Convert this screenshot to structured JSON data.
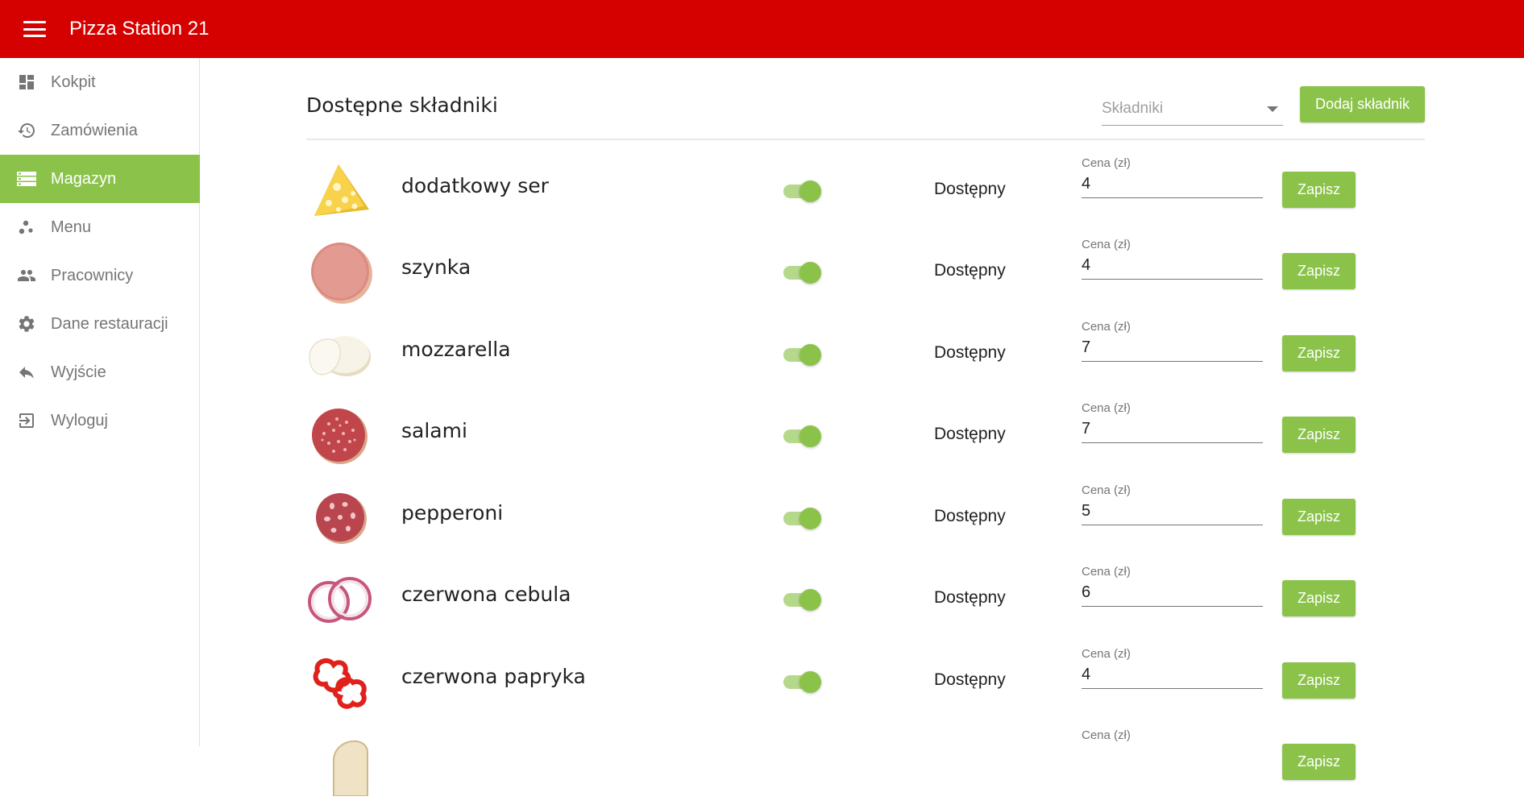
{
  "app": {
    "title": "Pizza Station 21"
  },
  "sidebar": {
    "items": [
      {
        "label": "Kokpit",
        "icon": "dashboard-icon",
        "active": false
      },
      {
        "label": "Zamówienia",
        "icon": "history-icon",
        "active": false
      },
      {
        "label": "Magazyn",
        "icon": "storage-icon",
        "active": true
      },
      {
        "label": "Menu",
        "icon": "bubbles-icon",
        "active": false
      },
      {
        "label": "Pracownicy",
        "icon": "people-icon",
        "active": false
      },
      {
        "label": "Dane restauracji",
        "icon": "gear-icon",
        "active": false
      },
      {
        "label": "Wyjście",
        "icon": "reply-icon",
        "active": false
      },
      {
        "label": "Wyloguj",
        "icon": "logout-icon",
        "active": false
      }
    ]
  },
  "main": {
    "title": "Dostępne składniki",
    "select_placeholder": "Składniki",
    "add_button": "Dodaj składnik",
    "price_label": "Cena (zł)",
    "available_label": "Dostępny",
    "save_label": "Zapisz",
    "ingredients": [
      {
        "name": "dodatkowy ser",
        "available": true,
        "price": "4",
        "icon": "cheese-icon"
      },
      {
        "name": "szynka",
        "available": true,
        "price": "4",
        "icon": "ham-icon"
      },
      {
        "name": "mozzarella",
        "available": true,
        "price": "7",
        "icon": "mozzarella-icon"
      },
      {
        "name": "salami",
        "available": true,
        "price": "7",
        "icon": "salami-icon"
      },
      {
        "name": "pepperoni",
        "available": true,
        "price": "5",
        "icon": "pepperoni-icon"
      },
      {
        "name": "czerwona cebula",
        "available": true,
        "price": "6",
        "icon": "red-onion-icon"
      },
      {
        "name": "czerwona papryka",
        "available": true,
        "price": "4",
        "icon": "red-pepper-icon"
      },
      {
        "name": "",
        "available": true,
        "price": "",
        "icon": "partial-ingredient-icon"
      }
    ]
  },
  "colors": {
    "header": "#d50000",
    "accent": "#8bc34a",
    "accent_light": "#b5d98b"
  }
}
